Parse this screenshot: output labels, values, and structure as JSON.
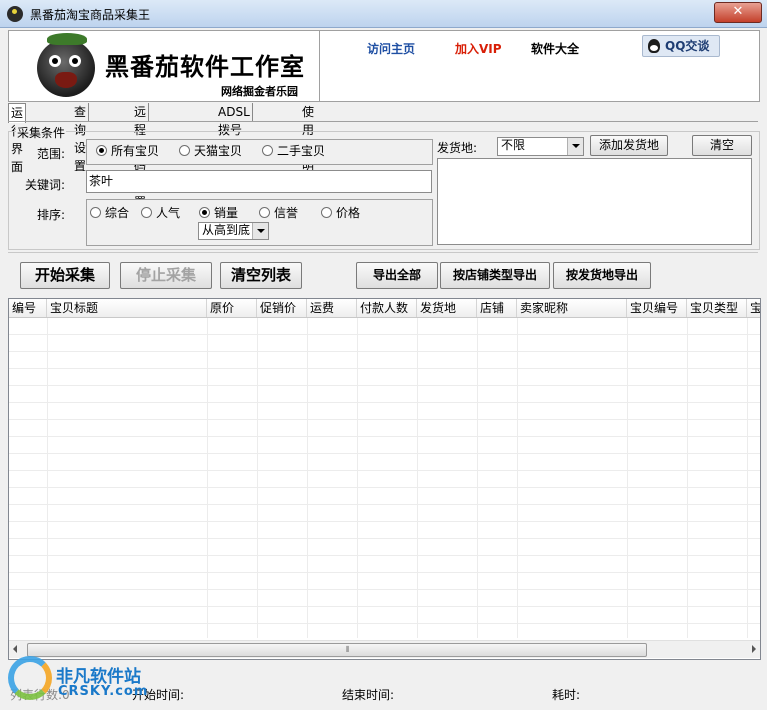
{
  "window": {
    "title": "黑番茄淘宝商品采集王",
    "close_label": "✕"
  },
  "banner": {
    "brand": "黑番茄软件工作室",
    "slogan": "网络掘金者乐园",
    "links": {
      "home": "访问主页",
      "vip": "加入VIP",
      "software": "软件大全"
    },
    "qq_button": "QQ交谈",
    "vip_color": "#d81e06",
    "home_color": "#1f4fa3"
  },
  "tabs": [
    "运行界面",
    "查询设置",
    "远程打码设置",
    "ADSL拨号设置",
    "使用说明"
  ],
  "criteria": {
    "group_title": "采集条件",
    "scope_label": "范围:",
    "scope_options": [
      "所有宝贝",
      "天猫宝贝",
      "二手宝贝"
    ],
    "keyword_label": "关键词:",
    "keyword_value": "茶叶",
    "sort_label": "排序:",
    "sort_options": [
      "综合",
      "人气",
      "销量",
      "信誉",
      "价格"
    ],
    "sort_order": "从高到底",
    "ship_label": "发货地:",
    "ship_value": "不限",
    "add_ship_button": "添加发货地",
    "clear_button": "清空"
  },
  "actions": {
    "start": "开始采集",
    "stop": "停止采集",
    "clear_list": "清空列表",
    "export_all": "导出全部",
    "export_by_shop": "按店铺类型导出",
    "export_by_ship": "按发货地导出"
  },
  "table": {
    "columns": [
      "编号",
      "宝贝标题",
      "原价",
      "促销价",
      "运费",
      "付款人数",
      "发货地",
      "店铺",
      "卖家昵称",
      "宝贝编号",
      "宝贝类型",
      "宝"
    ]
  },
  "status": {
    "list_count": "列表行数:0",
    "start_time": "开始时间:",
    "end_time": "结束时间:",
    "elapsed": "耗时:"
  },
  "watermark": {
    "name": "非凡软件站",
    "site": "CRSKY.com"
  }
}
